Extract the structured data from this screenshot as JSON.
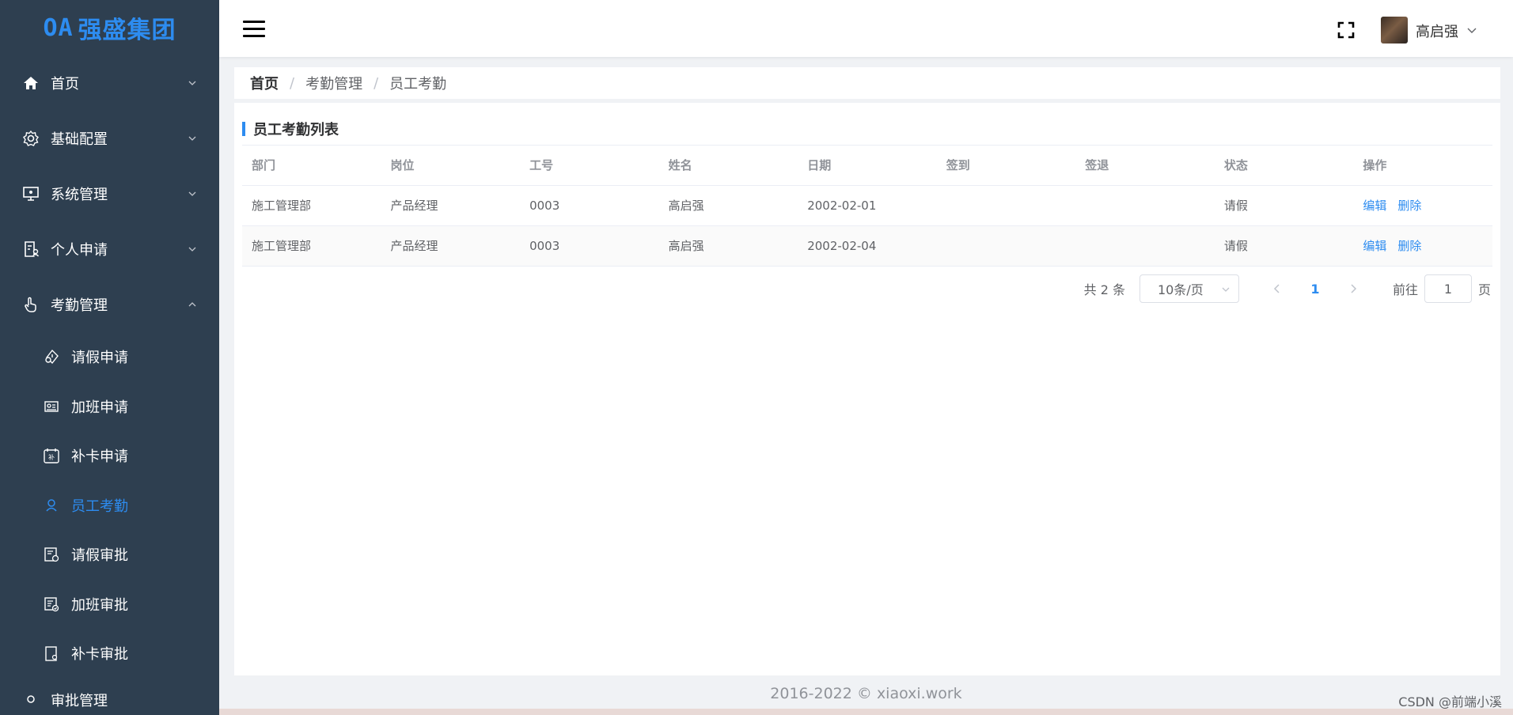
{
  "app": {
    "logo_prefix": "OA",
    "logo_text": "强盛集团"
  },
  "sidebar": {
    "menus": [
      {
        "label": "首页",
        "icon": "home-icon"
      },
      {
        "label": "基础配置",
        "icon": "gear-icon"
      },
      {
        "label": "系统管理",
        "icon": "monitor-icon"
      },
      {
        "label": "个人申请",
        "icon": "document-user-icon"
      },
      {
        "label": "考勤管理",
        "icon": "hand-pointer-icon"
      }
    ],
    "submenus": [
      {
        "label": "请假申请",
        "icon": "leave-icon"
      },
      {
        "label": "加班申请",
        "icon": "overtime-icon"
      },
      {
        "label": "补卡申请",
        "icon": "calendar-patch-icon"
      },
      {
        "label": "员工考勤",
        "icon": "person-icon",
        "active": true
      },
      {
        "label": "请假审批",
        "icon": "approve-leave-icon"
      },
      {
        "label": "加班审批",
        "icon": "approve-overtime-icon"
      },
      {
        "label": "补卡审批",
        "icon": "approve-patch-icon"
      }
    ],
    "cut_menu": {
      "label": "审批管理"
    }
  },
  "header": {
    "username": "高启强"
  },
  "breadcrumb": {
    "home": "首页",
    "section": "考勤管理",
    "current": "员工考勤"
  },
  "card": {
    "title": "员工考勤列表"
  },
  "table": {
    "columns": [
      "部门",
      "岗位",
      "工号",
      "姓名",
      "日期",
      "签到",
      "签退",
      "状态",
      "操作"
    ],
    "rows": [
      {
        "dept": "施工管理部",
        "position": "产品经理",
        "emp_no": "0003",
        "name": "高启强",
        "date": "2002-02-01",
        "checkin": "",
        "checkout": "",
        "status": "请假"
      },
      {
        "dept": "施工管理部",
        "position": "产品经理",
        "emp_no": "0003",
        "name": "高启强",
        "date": "2002-02-04",
        "checkin": "",
        "checkout": "",
        "status": "请假"
      }
    ],
    "edit_label": "编辑",
    "delete_label": "删除"
  },
  "pagination": {
    "total": "共 2 条",
    "page_size": "10条/页",
    "current_page": "1",
    "goto_label": "前往",
    "goto_value": "1",
    "goto_suffix": "页"
  },
  "footer": {
    "copyright": "2016-2022 © xiaoxi.work",
    "watermark": "CSDN @前端小溪"
  },
  "colors": {
    "sidebar_bg": "#2e3f50",
    "accent": "#2d8cf0"
  }
}
